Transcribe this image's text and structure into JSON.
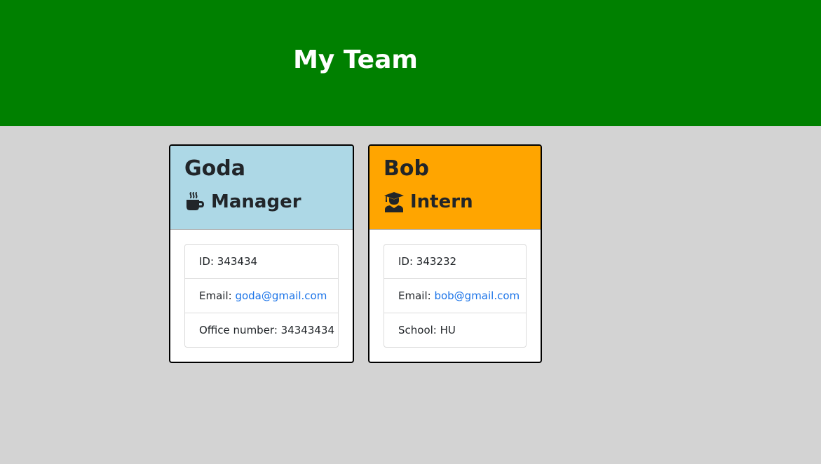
{
  "header": {
    "title": "My Team",
    "background_color": "#008000"
  },
  "cards": [
    {
      "name": "Goda",
      "role": "Manager",
      "role_icon": "coffee-mug-icon",
      "header_color": "#add8e6",
      "id_label": "ID: ",
      "id_value": "343434",
      "email_label": "Email: ",
      "email_value": "goda@gmail.com",
      "extra_label": "Office number: ",
      "extra_value": "34343434"
    },
    {
      "name": "Bob",
      "role": "Intern",
      "role_icon": "graduate-icon",
      "header_color": "#ffa500",
      "id_label": "ID: ",
      "id_value": "343232",
      "email_label": "Email: ",
      "email_value": "bob@gmail.com",
      "extra_label": "School: ",
      "extra_value": "HU"
    }
  ],
  "colors": {
    "page_background": "#d3d3d3",
    "link": "#1a73e8"
  }
}
